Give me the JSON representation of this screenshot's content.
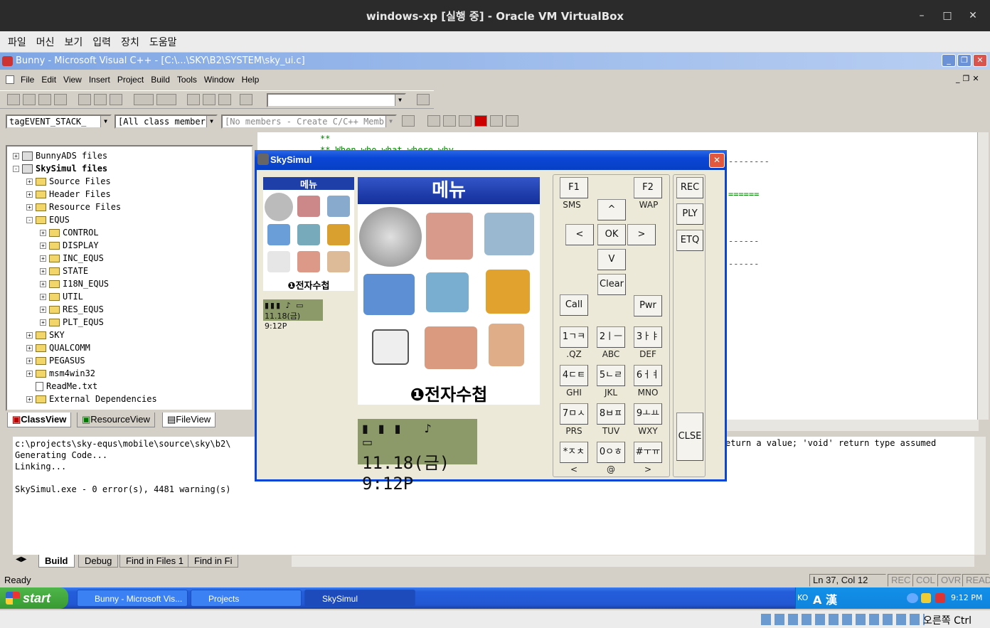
{
  "vbox": {
    "title": "windows-xp [실행 중] - Oracle VM VirtualBox",
    "menu": [
      "파일",
      "머신",
      "보기",
      "입력",
      "장치",
      "도움말"
    ],
    "host_key": "오른쪽 Ctrl"
  },
  "vc": {
    "title": "Bunny - Microsoft Visual C++ - [C:\\...\\SKY\\B2\\SYSTEM\\sky_ui.c]",
    "menu": [
      "File",
      "Edit",
      "View",
      "Insert",
      "Project",
      "Build",
      "Tools",
      "Window",
      "Help"
    ],
    "combo1": "tagEVENT_STACK_",
    "combo2": "[All class members]",
    "combo3": "[No members - Create C/C++ Memb"
  },
  "tree": [
    {
      "label": "BunnyADS files",
      "indent": 0,
      "type": "proj",
      "exp": "+"
    },
    {
      "label": "SkySimul files",
      "indent": 0,
      "type": "proj",
      "exp": "-",
      "bold": true
    },
    {
      "label": "Source Files",
      "indent": 1,
      "type": "folder",
      "exp": "+"
    },
    {
      "label": "Header Files",
      "indent": 1,
      "type": "folder",
      "exp": "+"
    },
    {
      "label": "Resource Files",
      "indent": 1,
      "type": "folder",
      "exp": "+"
    },
    {
      "label": "EQUS",
      "indent": 1,
      "type": "folder",
      "exp": "-"
    },
    {
      "label": "CONTROL",
      "indent": 2,
      "type": "folder",
      "exp": "+"
    },
    {
      "label": "DISPLAY",
      "indent": 2,
      "type": "folder",
      "exp": "+"
    },
    {
      "label": "INC_EQUS",
      "indent": 2,
      "type": "folder",
      "exp": "+"
    },
    {
      "label": "STATE",
      "indent": 2,
      "type": "folder",
      "exp": "+"
    },
    {
      "label": "I18N_EQUS",
      "indent": 2,
      "type": "folder",
      "exp": "+"
    },
    {
      "label": "UTIL",
      "indent": 2,
      "type": "folder",
      "exp": "+"
    },
    {
      "label": "RES_EQUS",
      "indent": 2,
      "type": "folder",
      "exp": "+"
    },
    {
      "label": "PLT_EQUS",
      "indent": 2,
      "type": "folder",
      "exp": "+"
    },
    {
      "label": "SKY",
      "indent": 1,
      "type": "folder",
      "exp": "+"
    },
    {
      "label": "QUALCOMM",
      "indent": 1,
      "type": "folder",
      "exp": "+"
    },
    {
      "label": "PEGASUS",
      "indent": 1,
      "type": "folder",
      "exp": "+"
    },
    {
      "label": "msm4win32",
      "indent": 1,
      "type": "folder",
      "exp": "+"
    },
    {
      "label": "ReadMe.txt",
      "indent": 1,
      "type": "file",
      "exp": ""
    },
    {
      "label": "External Dependencies",
      "indent": 1,
      "type": "folder",
      "exp": "+"
    }
  ],
  "ws_tabs": [
    "ClassView",
    "ResourceView",
    "FileView"
  ],
  "editor_lines": [
    "**",
    "** When         who          what   where   why"
  ],
  "output_lines": [
    "c:\\projects\\sky-equs\\mobile\\source\\sky\\b2\\",
    "Generating Code...",
    "Linking...",
    "",
    "SkySimul.exe - 0 error(s), 4481 warning(s)"
  ],
  "output_right": "eturn a value; 'void' return type assumed",
  "out_tabs": [
    "Build",
    "Debug",
    "Find in Files 1",
    "Find in Fi"
  ],
  "status": {
    "ready": "Ready",
    "pos": "Ln 37, Col 12",
    "rec": "REC",
    "col": "COL",
    "ovr": "OVR",
    "read": "READ"
  },
  "sky": {
    "title": "SkySimul",
    "small_header": "메뉴",
    "big_header": "메뉴",
    "small_caption": "❶전자수첩",
    "big_caption": "❶전자수첩",
    "small_lcd": "11.18(금) 9:12P",
    "big_lcd": "11.18(금) 9:12P",
    "keys": {
      "f1": "F1",
      "f2": "F2",
      "sms": "SMS",
      "wap": "WAP",
      "up": "^",
      "left": "<",
      "ok": "OK",
      "right": ">",
      "down": "V",
      "clear": "Clear",
      "call": "Call",
      "pwr": "Pwr",
      "k1": "1ㄱㅋ",
      "k2": "2ㅣㅡ",
      "k3": "3ㅏㅑ",
      "k4": "4ㄷㅌ",
      "k5": "5ㄴㄹ",
      "k6": "6ㅓㅕ",
      "k7": "7ㅁㅅ",
      "k8": "8ㅂㅍ",
      "k9": "9ㅗㅛ",
      "kstar": "*ㅈㅊ",
      "k0": "0ㅇㅎ",
      "khash": "#ㅜㅠ",
      "l1": ".QZ",
      "l2": "ABC",
      "l3": "DEF",
      "l4": "GHI",
      "l5": "JKL",
      "l6": "MNO",
      "l7": "PRS",
      "l8": "TUV",
      "l9": "WXY",
      "lstar": "<",
      "l0": "@",
      "lhash": ">"
    },
    "side": [
      "REC",
      "PLY",
      "ETQ",
      "CLSE"
    ]
  },
  "taskbar": {
    "start": "start",
    "tasks": [
      "Bunny - Microsoft Vis...",
      "Projects",
      "SkySimul"
    ],
    "lang": "KO",
    "time": "9:12 PM",
    "ime": "A 漢"
  }
}
